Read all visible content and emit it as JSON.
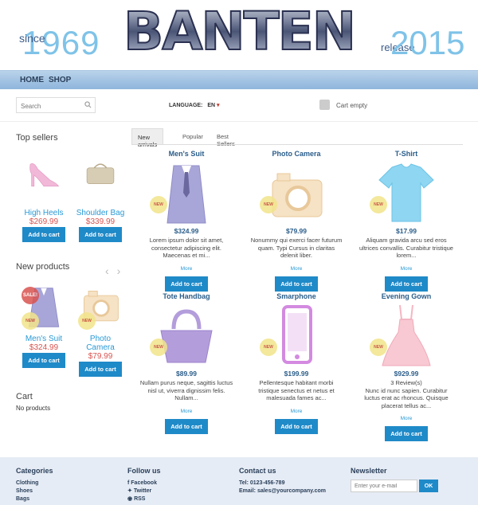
{
  "header": {
    "since_label": "since",
    "since_year": "1969",
    "logo_text": "BANTEN",
    "release_label": "release",
    "release_year": "2015"
  },
  "nav": {
    "items": [
      "HOME",
      "SHOP"
    ]
  },
  "search": {
    "placeholder": "Search"
  },
  "language": {
    "label": "LANGUAGE:",
    "value": "EN"
  },
  "cart": {
    "status": "Cart empty"
  },
  "sidebar": {
    "top_sellers_title": "Top sellers",
    "top_sellers": [
      {
        "name": "High Heels",
        "price": "$269.99",
        "button": "Add to cart"
      },
      {
        "name": "Shoulder Bag",
        "price": "$339.99",
        "button": "Add to cart"
      }
    ],
    "new_products_title": "New products",
    "new_products": [
      {
        "name": "Men's Suit",
        "price": "$324.99",
        "button": "Add to cart",
        "badges": [
          "SALE!",
          "NEW"
        ]
      },
      {
        "name": "Photo Camera",
        "price": "$79.99",
        "button": "Add to cart",
        "badges": [
          "NEW"
        ]
      }
    ],
    "cart_title": "Cart",
    "cart_text": "No products"
  },
  "tabs": [
    "New arrivals",
    "Popular",
    "Best Sellers"
  ],
  "products": [
    {
      "title": "Men's Suit",
      "price": "$324.99",
      "desc": "Lorem ipsum dolor sit amet, consectetur adipiscing elit. Maecenas et mi...",
      "more": "More",
      "button": "Add to cart",
      "badge": "NEW"
    },
    {
      "title": "Photo Camera",
      "price": "$79.99",
      "desc": "Nonummy qui exerci facer futurum quam. Typi Cursus in claritas delenit liber.",
      "more": "More",
      "button": "Add to cart",
      "badge": "NEW"
    },
    {
      "title": "T-Shirt",
      "price": "$17.99",
      "desc": "Aliquam gravida arcu sed eros ultrices convallis. Curabitur tristique lorem...",
      "more": "More",
      "button": "Add to cart",
      "badge": "NEW"
    },
    {
      "title": "Tote Handbag",
      "price": "$89.99",
      "desc": "Nullam purus neque, sagittis luctus nisl ut, viverra dignissim felis. Nullam...",
      "more": "More",
      "button": "Add to cart",
      "badge": "NEW"
    },
    {
      "title": "Smarphone",
      "price": "$199.99",
      "desc": "Pellentesque habitant morbi tristique senectus et netus et malesuada fames ac...",
      "more": "More",
      "button": "Add to cart",
      "badge": "NEW"
    },
    {
      "title": "Evening Gown",
      "price": "$929.99",
      "reviews": "3 Review(s)",
      "desc": "Nunc id nunc sapien. Curabitur luctus erat ac rhoncus. Quisque placerat tellus ac...",
      "more": "More",
      "button": "Add to cart",
      "badge": "NEW"
    }
  ],
  "footer": {
    "categories_title": "Categories",
    "categories": [
      "Clothing",
      "Shoes",
      "Bags"
    ],
    "follow_title": "Follow us",
    "follow": [
      "Facebook",
      "Twitter",
      "RSS"
    ],
    "contact_title": "Contact us",
    "contact": [
      "Tel: 0123-456-789",
      "Email: sales@yourcompany.com"
    ],
    "newsletter_title": "Newsletter",
    "newsletter_placeholder": "Enter your e-mail",
    "newsletter_button": "OK"
  },
  "colors": {
    "accent": "#1f8ac8",
    "price_red": "#d9534f",
    "link": "#2a9ad6",
    "year": "#7fc3e8"
  }
}
